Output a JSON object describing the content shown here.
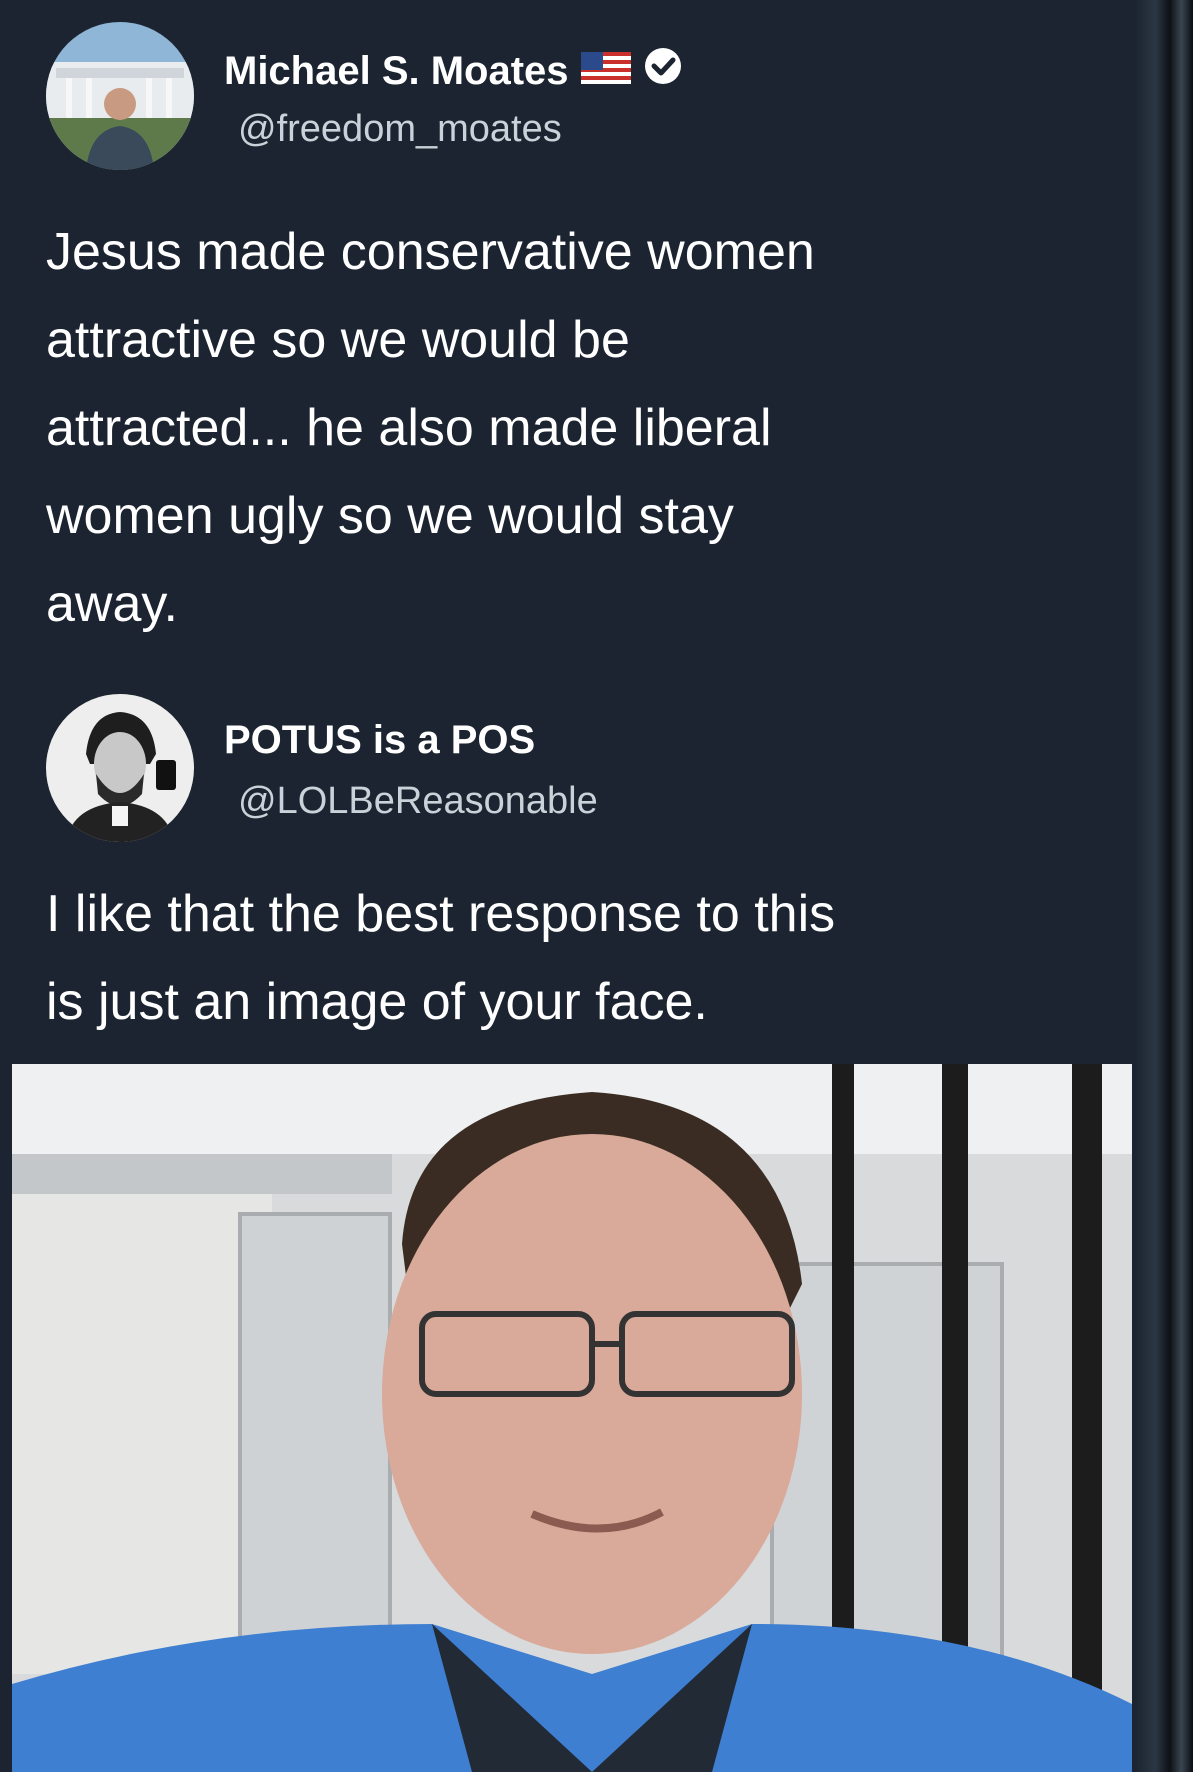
{
  "tweet": {
    "author_name": "Michael S. Moates",
    "author_handle": "@freedom_moates",
    "author_flag_icon": "us-flag-icon",
    "author_badge_icon": "verified-badge-icon",
    "text": "Jesus made conservative women\nattractive so we would be\nattracted... he also made liberal\nwomen ugly so we would stay\naway."
  },
  "reply": {
    "author_name": "POTUS is a POS",
    "author_handle": "@LOLBeReasonable",
    "text": "I like that the best response to this\nis just an image of your face."
  },
  "colors": {
    "background": "#1b2430",
    "text": "#ffffff",
    "handle": "#c9d1d9"
  }
}
